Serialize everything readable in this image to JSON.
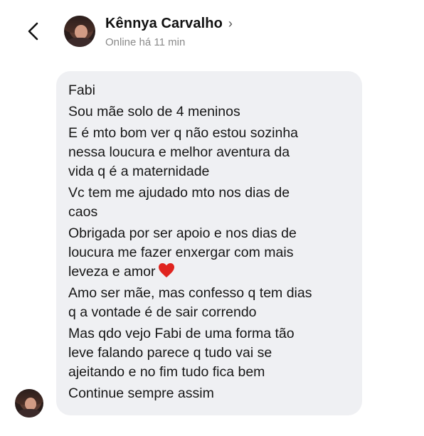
{
  "header": {
    "contact_name": "Kênnya Carvalho",
    "status": "Online há 11 min",
    "back_icon": "chevron-left-icon",
    "profile_chevron_icon": "chevron-right-icon"
  },
  "message": {
    "lines": [
      "Fabi",
      "Sou mãe solo de 4 meninos",
      "E é mto bom ver q não estou sozinha",
      "nessa loucura e melhor aventura da",
      "vida q é a maternidade",
      "Vc tem me ajudado mto nos dias de",
      "caos",
      "Obrigada por ser apoio e nos dias de",
      "loucura me fazer enxergar com mais",
      "leveza e amor",
      "Amo ser mãe, mas confesso q tem dias",
      "q a vontade é de sair correndo",
      "Mas qdo vejo Fabi de uma forma tão",
      "leve falando parece q tudo vai se",
      "ajeitando e no fim tudo fica bem",
      "Continue sempre assim"
    ],
    "emoji": "red-heart-icon",
    "bubble_color": "#eff0f3",
    "heart_color": "#e0241f"
  }
}
